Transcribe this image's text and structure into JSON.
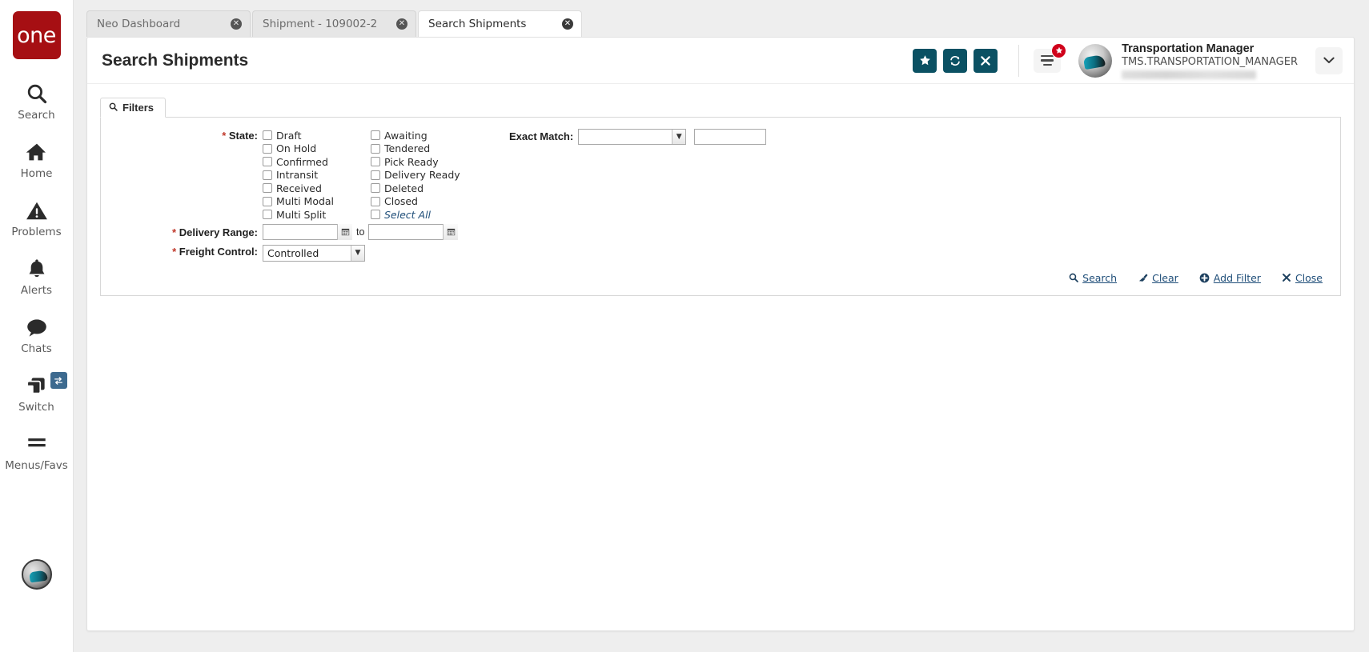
{
  "brand": {
    "logo_text": "one",
    "logo_color": "#a60f13",
    "accent_teal": "#0b5163",
    "link_blue": "#1f4e79",
    "required_red": "#c0392b"
  },
  "sidebar": {
    "items": [
      {
        "icon": "search-icon",
        "label": "Search"
      },
      {
        "icon": "home-icon",
        "label": "Home"
      },
      {
        "icon": "problems-warning-icon",
        "label": "Problems"
      },
      {
        "icon": "bell-icon",
        "label": "Alerts"
      },
      {
        "icon": "chat-bubble-icon",
        "label": "Chats"
      },
      {
        "icon": "switch-windows-icon",
        "label": "Switch",
        "badge_icon": "swap-arrows-icon"
      },
      {
        "icon": "hamburger-icon",
        "label": "Menus/Favs"
      }
    ]
  },
  "tabs": [
    {
      "label": "Neo Dashboard",
      "active": false,
      "close_icon": "close-circle-icon"
    },
    {
      "label": "Shipment - 109002-2",
      "active": false,
      "close_icon": "close-circle-icon"
    },
    {
      "label": "Search Shipments",
      "active": true,
      "close_icon": "close-circle-icon"
    }
  ],
  "header": {
    "title": "Search Shipments",
    "buttons": [
      {
        "name": "favorite-button",
        "icon": "star-icon",
        "glyph": "★"
      },
      {
        "name": "refresh-button",
        "icon": "refresh-icon",
        "glyph": "⟳"
      },
      {
        "name": "close-page-button",
        "icon": "close-icon",
        "glyph": "✕"
      }
    ],
    "menu_button": {
      "icon": "hamburger-menu-icon",
      "badge_icon": "star-badge-icon",
      "badge_glyph": "★"
    },
    "user": {
      "name": "Transportation Manager",
      "login": "TMS.TRANSPORTATION_MANAGER"
    },
    "dropdown_icon": "chevron-down-icon",
    "dropdown_glyph": "⌄"
  },
  "filters": {
    "tab_label": "Filters",
    "tab_icon": "search-icon",
    "state": {
      "label": "State:",
      "required": true,
      "column1": [
        {
          "label": "Draft",
          "checked": false
        },
        {
          "label": "On Hold",
          "checked": false
        },
        {
          "label": "Confirmed",
          "checked": false
        },
        {
          "label": "Intransit",
          "checked": false
        },
        {
          "label": "Received",
          "checked": false
        },
        {
          "label": "Multi Modal",
          "checked": false
        },
        {
          "label": "Multi Split",
          "checked": false
        }
      ],
      "column2": [
        {
          "label": "Awaiting",
          "checked": false
        },
        {
          "label": "Tendered",
          "checked": false
        },
        {
          "label": "Pick Ready",
          "checked": false
        },
        {
          "label": "Delivery Ready",
          "checked": false
        },
        {
          "label": "Deleted",
          "checked": false
        },
        {
          "label": "Closed",
          "checked": false
        },
        {
          "label": "Select All",
          "checked": false,
          "is_link": true
        }
      ]
    },
    "exact_match": {
      "label": "Exact Match:",
      "select_value": "",
      "text_value": "",
      "dropdown_icon": "chevron-down-icon"
    },
    "delivery_range": {
      "label": "Delivery Range:",
      "required": true,
      "from_value": "",
      "to_value": "",
      "separator": "to",
      "calendar_icon": "calendar-icon"
    },
    "freight_control": {
      "label": "Freight Control:",
      "required": true,
      "value": "Controlled",
      "dropdown_icon": "chevron-down-icon"
    },
    "actions": [
      {
        "label": "Search",
        "icon": "search-icon"
      },
      {
        "label": "Clear",
        "icon": "eraser-icon"
      },
      {
        "label": "Add Filter",
        "icon": "plus-circle-icon"
      },
      {
        "label": "Close",
        "icon": "x-icon"
      }
    ]
  }
}
